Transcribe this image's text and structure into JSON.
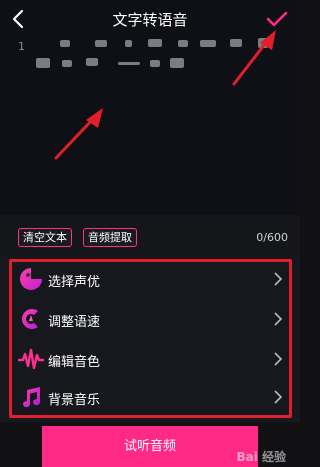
{
  "header": {
    "title": "文字转语音",
    "back_icon": "back-chevron-icon",
    "confirm_icon": "checkmark-icon"
  },
  "editor": {
    "line_number": "1"
  },
  "actions": {
    "clear_label": "清空文本",
    "extract_label": "音频提取",
    "char_count": "0/600"
  },
  "menu": {
    "items": [
      {
        "label": "选择声优",
        "icon": "voice-actor-icon"
      },
      {
        "label": "调整语速",
        "icon": "speed-icon"
      },
      {
        "label": "编辑音色",
        "icon": "waveform-icon"
      },
      {
        "label": "背景音乐",
        "icon": "music-note-icon"
      }
    ]
  },
  "footer": {
    "listen_label": "试听音频"
  },
  "colors": {
    "accent": "#ff2a86",
    "highlight": "#e01f2b",
    "background": "#111114"
  }
}
